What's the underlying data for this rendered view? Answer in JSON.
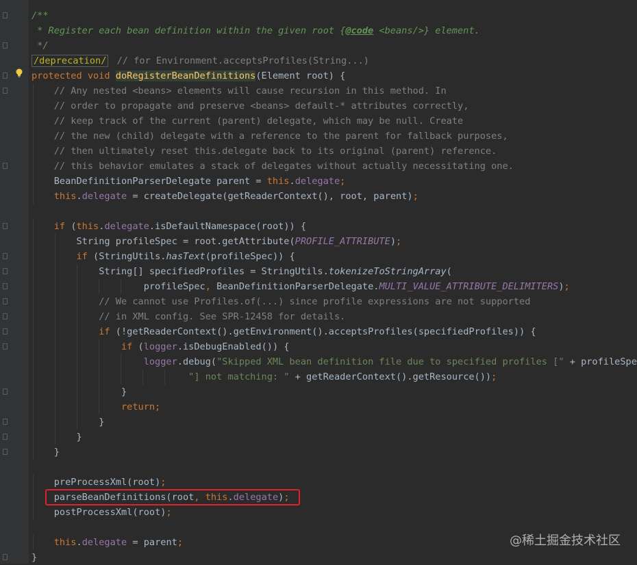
{
  "lines": [
    {
      "indent": 0,
      "tokens": [
        {
          "t": "/**",
          "c": "c-doc"
        }
      ]
    },
    {
      "indent": 0,
      "tokens": [
        {
          "t": " * Register each bean definition within the given root {",
          "c": "c-doc"
        },
        {
          "t": "@code",
          "c": "c-doctag"
        },
        {
          "t": " <beans/>} element.",
          "c": "c-doc"
        }
      ]
    },
    {
      "indent": 0,
      "tokens": [
        {
          "t": " */",
          "c": "c-doc"
        }
      ]
    },
    {
      "indent": 0,
      "tokens": [
        {
          "t": "/deprecation/",
          "c": "c-annot tag-box"
        },
        {
          "t": " // for Environment.acceptsProfiles(String...)",
          "c": "c-comment"
        }
      ]
    },
    {
      "indent": 0,
      "tokens": [
        {
          "t": "protected void ",
          "c": "c-kw"
        },
        {
          "t": "doRegisterBeanDefinitions",
          "c": "c-method-decl"
        },
        {
          "t": "(Element root) {",
          "c": "c-plain"
        }
      ]
    },
    {
      "indent": 4,
      "tokens": [
        {
          "t": "// Any nested <beans> elements will cause recursion in this method. In",
          "c": "c-comment"
        }
      ]
    },
    {
      "indent": 4,
      "tokens": [
        {
          "t": "// order to propagate and preserve <beans> default-* attributes correctly,",
          "c": "c-comment"
        }
      ]
    },
    {
      "indent": 4,
      "tokens": [
        {
          "t": "// keep track of the current (parent) delegate, which may be null. Create",
          "c": "c-comment"
        }
      ]
    },
    {
      "indent": 4,
      "tokens": [
        {
          "t": "// the new (child) delegate with a reference to the parent for fallback purposes,",
          "c": "c-comment"
        }
      ]
    },
    {
      "indent": 4,
      "tokens": [
        {
          "t": "// then ultimately reset this.delegate back to its original (parent) reference.",
          "c": "c-comment"
        }
      ]
    },
    {
      "indent": 4,
      "tokens": [
        {
          "t": "// this behavior emulates a stack of delegates without actually necessitating one.",
          "c": "c-comment"
        }
      ]
    },
    {
      "indent": 4,
      "tokens": [
        {
          "t": "BeanDefinitionParserDelegate parent = ",
          "c": "c-plain"
        },
        {
          "t": "this",
          "c": "c-kw"
        },
        {
          "t": ".",
          "c": "c-plain"
        },
        {
          "t": "delegate",
          "c": "c-field"
        },
        {
          "t": ";",
          "c": "c-kw"
        }
      ]
    },
    {
      "indent": 4,
      "tokens": [
        {
          "t": "this",
          "c": "c-kw"
        },
        {
          "t": ".",
          "c": "c-plain"
        },
        {
          "t": "delegate",
          "c": "c-field"
        },
        {
          "t": " = createDelegate(getReaderContext(), root, parent)",
          "c": "c-plain"
        },
        {
          "t": ";",
          "c": "c-kw"
        }
      ]
    },
    {
      "indent": 0,
      "tokens": []
    },
    {
      "indent": 4,
      "tokens": [
        {
          "t": "if ",
          "c": "c-kw"
        },
        {
          "t": "(",
          "c": "c-plain"
        },
        {
          "t": "this",
          "c": "c-kw"
        },
        {
          "t": ".",
          "c": "c-plain"
        },
        {
          "t": "delegate",
          "c": "c-field"
        },
        {
          "t": ".isDefaultNamespace(root)) {",
          "c": "c-plain"
        }
      ]
    },
    {
      "indent": 8,
      "tokens": [
        {
          "t": "String profileSpec = root.getAttribute(",
          "c": "c-plain"
        },
        {
          "t": "PROFILE_ATTRIBUTE",
          "c": "c-const"
        },
        {
          "t": ")",
          "c": "c-plain"
        },
        {
          "t": ";",
          "c": "c-kw"
        }
      ]
    },
    {
      "indent": 8,
      "tokens": [
        {
          "t": "if ",
          "c": "c-kw"
        },
        {
          "t": "(StringUtils.",
          "c": "c-plain"
        },
        {
          "t": "hasText",
          "c": "c-static"
        },
        {
          "t": "(profileSpec)) {",
          "c": "c-plain"
        }
      ]
    },
    {
      "indent": 12,
      "tokens": [
        {
          "t": "String[] specifiedProfiles = StringUtils.",
          "c": "c-plain"
        },
        {
          "t": "tokenizeToStringArray",
          "c": "c-static"
        },
        {
          "t": "(",
          "c": "c-plain"
        }
      ]
    },
    {
      "indent": 20,
      "tokens": [
        {
          "t": "profileSpec",
          "c": "c-plain"
        },
        {
          "t": ", ",
          "c": "c-kw"
        },
        {
          "t": "BeanDefinitionParserDelegate.",
          "c": "c-plain"
        },
        {
          "t": "MULTI_VALUE_ATTRIBUTE_DELIMITERS",
          "c": "c-const"
        },
        {
          "t": ")",
          "c": "c-plain"
        },
        {
          "t": ";",
          "c": "c-kw"
        }
      ]
    },
    {
      "indent": 12,
      "tokens": [
        {
          "t": "// We cannot use Profiles.of(...) since profile expressions are not supported",
          "c": "c-comment"
        }
      ]
    },
    {
      "indent": 12,
      "tokens": [
        {
          "t": "// in XML config. See SPR-12458 for details.",
          "c": "c-comment"
        }
      ]
    },
    {
      "indent": 12,
      "tokens": [
        {
          "t": "if ",
          "c": "c-kw"
        },
        {
          "t": "(!getReaderContext().getEnvironment().acceptsProfiles(specifiedProfiles)) {",
          "c": "c-plain"
        }
      ]
    },
    {
      "indent": 16,
      "tokens": [
        {
          "t": "if ",
          "c": "c-kw"
        },
        {
          "t": "(",
          "c": "c-plain"
        },
        {
          "t": "logger",
          "c": "c-field"
        },
        {
          "t": ".isDebugEnabled()) {",
          "c": "c-plain"
        }
      ]
    },
    {
      "indent": 20,
      "tokens": [
        {
          "t": "logger",
          "c": "c-field"
        },
        {
          "t": ".debug(",
          "c": "c-plain"
        },
        {
          "t": "\"Skipped XML bean definition file due to specified profiles [\"",
          "c": "c-str"
        },
        {
          "t": " + profileSpec +",
          "c": "c-plain"
        }
      ]
    },
    {
      "indent": 28,
      "tokens": [
        {
          "t": "\"] not matching: \"",
          "c": "c-str"
        },
        {
          "t": " + getReaderContext().getResource())",
          "c": "c-plain"
        },
        {
          "t": ";",
          "c": "c-kw"
        }
      ]
    },
    {
      "indent": 16,
      "tokens": [
        {
          "t": "}",
          "c": "c-plain"
        }
      ]
    },
    {
      "indent": 16,
      "tokens": [
        {
          "t": "return;",
          "c": "c-kw"
        }
      ]
    },
    {
      "indent": 12,
      "tokens": [
        {
          "t": "}",
          "c": "c-plain"
        }
      ]
    },
    {
      "indent": 8,
      "tokens": [
        {
          "t": "}",
          "c": "c-plain"
        }
      ]
    },
    {
      "indent": 4,
      "tokens": [
        {
          "t": "}",
          "c": "c-plain"
        }
      ]
    },
    {
      "indent": 0,
      "tokens": []
    },
    {
      "indent": 4,
      "tokens": [
        {
          "t": "preProcessXml(root)",
          "c": "c-plain"
        },
        {
          "t": ";",
          "c": "c-kw"
        }
      ]
    },
    {
      "indent": 4,
      "tokens": [
        {
          "t": "parseBeanDefinitions(root",
          "c": "c-plain"
        },
        {
          "t": ", ",
          "c": "c-kw"
        },
        {
          "t": "this",
          "c": "c-kw"
        },
        {
          "t": ".",
          "c": "c-plain"
        },
        {
          "t": "delegate",
          "c": "c-field"
        },
        {
          "t": ")",
          "c": "c-plain"
        },
        {
          "t": ";",
          "c": "c-kw"
        }
      ]
    },
    {
      "indent": 4,
      "tokens": [
        {
          "t": "postProcessXml(root)",
          "c": "c-plain"
        },
        {
          "t": ";",
          "c": "c-kw"
        }
      ]
    },
    {
      "indent": 0,
      "tokens": []
    },
    {
      "indent": 4,
      "tokens": [
        {
          "t": "this",
          "c": "c-kw"
        },
        {
          "t": ".",
          "c": "c-plain"
        },
        {
          "t": "delegate",
          "c": "c-field"
        },
        {
          "t": " = parent",
          "c": "c-plain"
        },
        {
          "t": ";",
          "c": "c-kw"
        }
      ]
    },
    {
      "indent": 0,
      "tokens": [
        {
          "t": "}",
          "c": "c-plain"
        }
      ]
    }
  ],
  "watermark": "@稀土掘金技术社区",
  "colors": {
    "background": "#2b2b2b",
    "gutter": "#313335",
    "highlight_border": "#e0222a"
  }
}
